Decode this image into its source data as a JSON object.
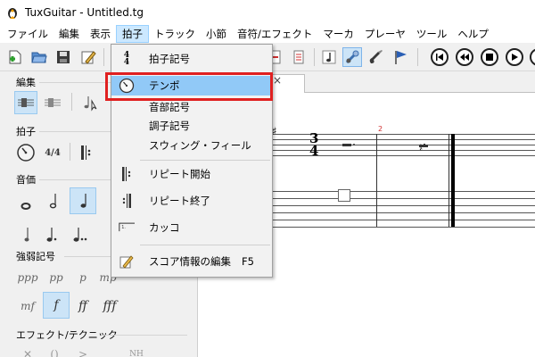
{
  "window": {
    "title": "TuxGuitar - Untitled.tg"
  },
  "menubar": {
    "items": [
      {
        "label": "ファイル"
      },
      {
        "label": "編集"
      },
      {
        "label": "表示"
      },
      {
        "label": "拍子"
      },
      {
        "label": "トラック"
      },
      {
        "label": "小節"
      },
      {
        "label": "音符/エフェクト"
      },
      {
        "label": "マーカ"
      },
      {
        "label": "プレーヤ"
      },
      {
        "label": "ツール"
      },
      {
        "label": "ヘルプ"
      }
    ],
    "active_index": 3
  },
  "dropdown": {
    "items": [
      {
        "label": "拍子記号",
        "icon": "time-signature-icon"
      },
      {
        "label": "テンポ",
        "icon": "metronome-icon",
        "highlighted": true
      },
      {
        "label": "音部記号"
      },
      {
        "label": "調子記号"
      },
      {
        "label": "スウィング・フィール"
      },
      {
        "label": "リピート開始",
        "icon": "repeat-open-icon"
      },
      {
        "label": "リピート終了",
        "icon": "repeat-close-icon"
      },
      {
        "label": "カッコ",
        "icon": "alternate-ending-icon"
      },
      {
        "label": "スコア情報の編集",
        "icon": "pencil-icon",
        "shortcut": "F5"
      }
    ]
  },
  "left_panel": {
    "sections": [
      {
        "title": "編集"
      },
      {
        "title": "拍子"
      },
      {
        "title": "音価"
      },
      {
        "title": "強弱記号"
      },
      {
        "title": "エフェクト/テクニック"
      }
    ],
    "dynamics": [
      "ppp",
      "pp",
      "p",
      "mp",
      "mf",
      "f",
      "ff",
      "fff"
    ],
    "time_sig_glyph": "4/4"
  },
  "score": {
    "measure_number": "2",
    "time_signature": {
      "top": "3",
      "bottom": "4"
    },
    "tab_close": "×"
  },
  "colors": {
    "highlight": "#91c9f7",
    "annotation_border": "#e02020",
    "toolbar_pressed": "#cce4f7"
  }
}
